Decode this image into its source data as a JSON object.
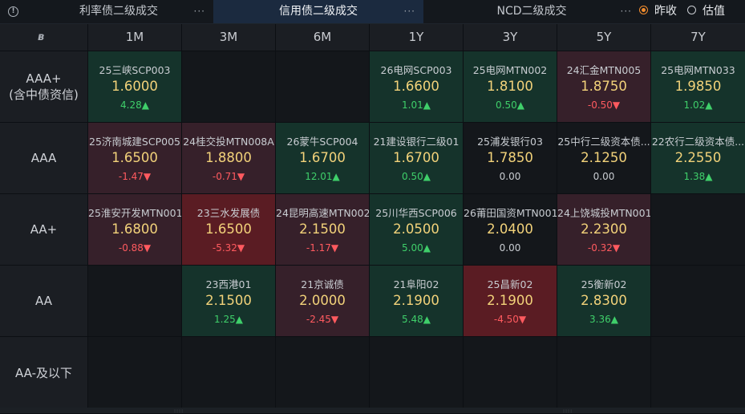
{
  "tabs": [
    {
      "label": "利率债二级成交",
      "more": "···"
    },
    {
      "label": "信用债二级成交",
      "more": "···"
    },
    {
      "label": "NCD二级成交",
      "more": "···"
    }
  ],
  "options": {
    "prev_close": "昨收",
    "valuation": "估值"
  },
  "corner_logo": "ʙ",
  "tenors": [
    "1M",
    "3M",
    "6M",
    "1Y",
    "3Y",
    "5Y",
    "7Y"
  ],
  "ratings": [
    {
      "line1": "AAA+",
      "line2": "(含中债资信)"
    },
    {
      "line1": "AAA",
      "line2": ""
    },
    {
      "line1": "AA+",
      "line2": ""
    },
    {
      "line1": "AA",
      "line2": ""
    },
    {
      "line1": "AA-及以下",
      "line2": ""
    }
  ],
  "cells": [
    [
      {
        "name": "25三峡SCP003",
        "price": "1.6000",
        "chg": "4.28▲",
        "dir": "up",
        "bg": "green"
      },
      null,
      null,
      {
        "name": "26电网SCP003",
        "price": "1.6600",
        "chg": "1.01▲",
        "dir": "up",
        "bg": "green"
      },
      {
        "name": "25电网MTN002",
        "price": "1.8100",
        "chg": "0.50▲",
        "dir": "up",
        "bg": "green"
      },
      {
        "name": "24汇金MTN005",
        "price": "1.8750",
        "chg": "-0.50▼",
        "dir": "down",
        "bg": "red"
      },
      {
        "name": "25电网MTN033",
        "price": "1.9850",
        "chg": "1.02▲",
        "dir": "up",
        "bg": "green"
      }
    ],
    [
      {
        "name": "25济南城建SCP005",
        "price": "1.6500",
        "chg": "-1.47▼",
        "dir": "down",
        "bg": "red"
      },
      {
        "name": "24桂交投MTN008A",
        "price": "1.8800",
        "chg": "-0.71▼",
        "dir": "down",
        "bg": "red"
      },
      {
        "name": "26蒙牛SCP004",
        "price": "1.6700",
        "chg": "12.01▲",
        "dir": "up",
        "bg": "green"
      },
      {
        "name": "21建设银行二级01",
        "price": "1.6700",
        "chg": "0.50▲",
        "dir": "up",
        "bg": "green"
      },
      {
        "name": "25浦发银行03",
        "price": "1.7850",
        "chg": "0.00",
        "dir": "flat",
        "bg": "none"
      },
      {
        "name": "25中行二级资本债...",
        "price": "2.1250",
        "chg": "0.00",
        "dir": "flat",
        "bg": "none"
      },
      {
        "name": "22农行二级资本债...",
        "price": "2.2550",
        "chg": "1.38▲",
        "dir": "up",
        "bg": "green"
      }
    ],
    [
      {
        "name": "25淮安开发MTN001",
        "price": "1.6800",
        "chg": "-0.88▼",
        "dir": "down",
        "bg": "red"
      },
      {
        "name": "23三水发展债",
        "price": "1.6500",
        "chg": "-5.32▼",
        "dir": "down",
        "bg": "bred"
      },
      {
        "name": "24昆明高速MTN002",
        "price": "2.1500",
        "chg": "-1.17▼",
        "dir": "down",
        "bg": "red"
      },
      {
        "name": "25川华西SCP006",
        "price": "2.0500",
        "chg": "5.00▲",
        "dir": "up",
        "bg": "green"
      },
      {
        "name": "26莆田国资MTN001",
        "price": "2.0400",
        "chg": "0.00",
        "dir": "flat",
        "bg": "none"
      },
      {
        "name": "24上饶城投MTN001",
        "price": "2.2300",
        "chg": "-0.32▼",
        "dir": "down",
        "bg": "red"
      },
      null
    ],
    [
      null,
      {
        "name": "23西港01",
        "price": "2.1500",
        "chg": "1.25▲",
        "dir": "up",
        "bg": "green"
      },
      {
        "name": "21京诚债",
        "price": "2.0000",
        "chg": "-2.45▼",
        "dir": "down",
        "bg": "red"
      },
      {
        "name": "21阜阳02",
        "price": "2.1900",
        "chg": "5.48▲",
        "dir": "up",
        "bg": "green"
      },
      {
        "name": "25昌新02",
        "price": "2.1900",
        "chg": "-4.50▼",
        "dir": "down",
        "bg": "bred"
      },
      {
        "name": "25衡新02",
        "price": "2.8300",
        "chg": "3.36▲",
        "dir": "up",
        "bg": "green"
      },
      null
    ],
    [
      null,
      null,
      null,
      null,
      null,
      null,
      null
    ]
  ]
}
